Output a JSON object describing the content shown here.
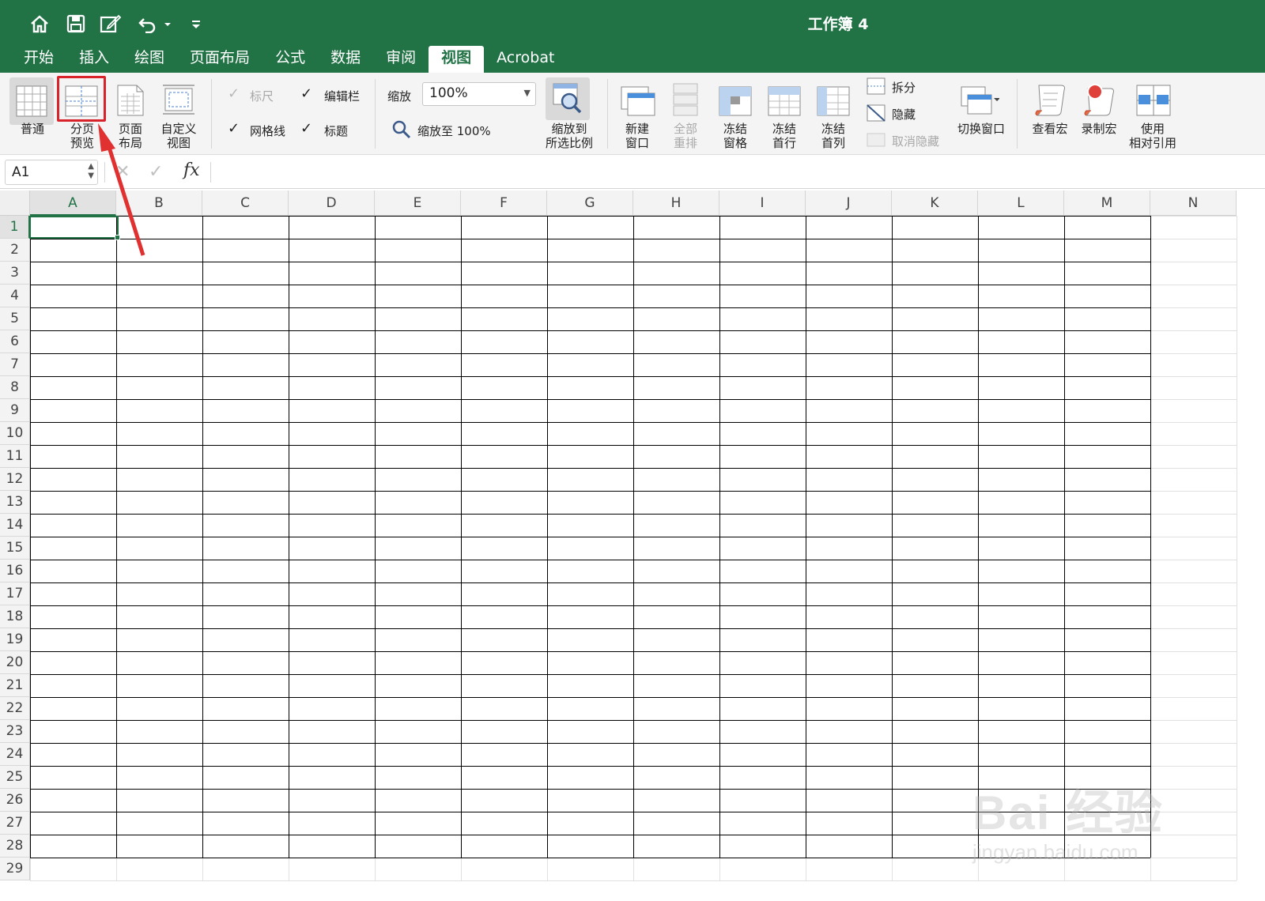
{
  "window": {
    "title": "工作簿 4"
  },
  "tabs": [
    {
      "label": "开始"
    },
    {
      "label": "插入"
    },
    {
      "label": "绘图"
    },
    {
      "label": "页面布局"
    },
    {
      "label": "公式"
    },
    {
      "label": "数据"
    },
    {
      "label": "审阅"
    },
    {
      "label": "视图",
      "active": true
    },
    {
      "label": "Acrobat"
    }
  ],
  "ribbon": {
    "views": {
      "normal": "普通",
      "page_break_1": "分页",
      "page_break_2": "预览",
      "page_layout_1": "页面",
      "page_layout_2": "布局",
      "custom_1": "自定义",
      "custom_2": "视图"
    },
    "show": {
      "ruler": "标尺",
      "formula_bar": "编辑栏",
      "gridlines": "网格线",
      "headings": "标题"
    },
    "zoom": {
      "label": "缩放",
      "value": "100%",
      "zoom100": "缩放至 100%",
      "to_selection_1": "缩放到",
      "to_selection_2": "所选比例"
    },
    "window": {
      "new_1": "新建",
      "new_2": "窗口",
      "arrange_1": "全部",
      "arrange_2": "重排",
      "freeze_panes_1": "冻结",
      "freeze_panes_2": "窗格",
      "freeze_row_1": "冻结",
      "freeze_row_2": "首行",
      "freeze_col_1": "冻结",
      "freeze_col_2": "首列",
      "split": "拆分",
      "hide": "隐藏",
      "unhide": "取消隐藏",
      "switch": "切换窗口"
    },
    "macros": {
      "view": "查看宏",
      "record": "录制宏",
      "relative_1": "使用",
      "relative_2": "相对引用"
    }
  },
  "formula_bar": {
    "name_box": "A1",
    "fx": "fx",
    "value": ""
  },
  "columns": [
    "A",
    "B",
    "C",
    "D",
    "E",
    "F",
    "G",
    "H",
    "I",
    "J",
    "K",
    "L",
    "M",
    "N"
  ],
  "rows": [
    "1",
    "2",
    "3",
    "4",
    "5",
    "6",
    "7",
    "8",
    "9",
    "10",
    "11",
    "12",
    "13",
    "14",
    "15",
    "16",
    "17",
    "18",
    "19",
    "20",
    "21",
    "22",
    "23",
    "24",
    "25",
    "26",
    "27",
    "28",
    "29"
  ],
  "watermark": {
    "line1": "Bai 经验",
    "line2": "jingyan.baidu.com"
  },
  "colors": {
    "brand": "#217346",
    "highlight": "#d8232a"
  }
}
